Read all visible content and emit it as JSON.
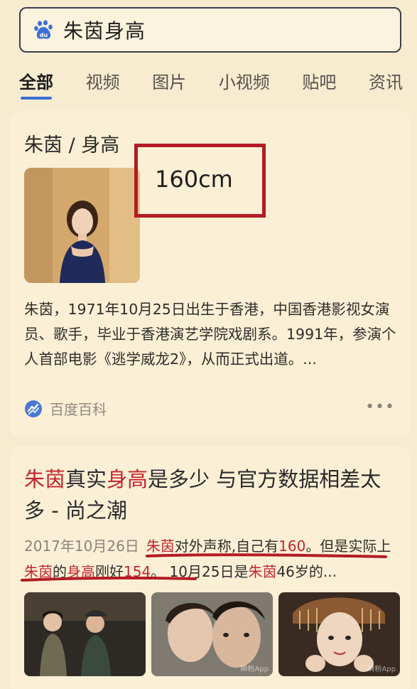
{
  "search": {
    "query": "朱茵身高",
    "logo_icon": "baidu-paw-icon"
  },
  "tabs": [
    {
      "label": "全部",
      "active": true
    },
    {
      "label": "视频"
    },
    {
      "label": "图片"
    },
    {
      "label": "小视频"
    },
    {
      "label": "贴吧"
    },
    {
      "label": "资讯"
    }
  ],
  "answer_card": {
    "title": "朱茵 / 身高",
    "value": "160cm",
    "description": "朱茵，1971年10月25日出生于香港，中国香港影视女演员、歌手，毕业于香港演艺学院戏剧系。1991年，参演个人首部电影《逃学威龙2》，从而正式出道。...",
    "source": "百度百科",
    "more_icon": "more-dots-icon",
    "highlight_color": "#b31c25"
  },
  "result_card": {
    "title_parts": [
      "朱茵",
      "真实",
      "身高",
      "是多少 与官方数据相差太多 - 尚之潮"
    ],
    "date": "2017年10月26日",
    "snippet_parts": [
      "朱茵",
      "对外声称,自己有",
      "160",
      "。但是实际上",
      "朱茵",
      "的",
      "身高",
      "刚好",
      "154",
      "。 10月25日是",
      "朱茵",
      "46岁的..."
    ],
    "thumb_watermarks": [
      "瞬粉App",
      "瞬粉App"
    ],
    "accent_color": "#c4252e"
  }
}
